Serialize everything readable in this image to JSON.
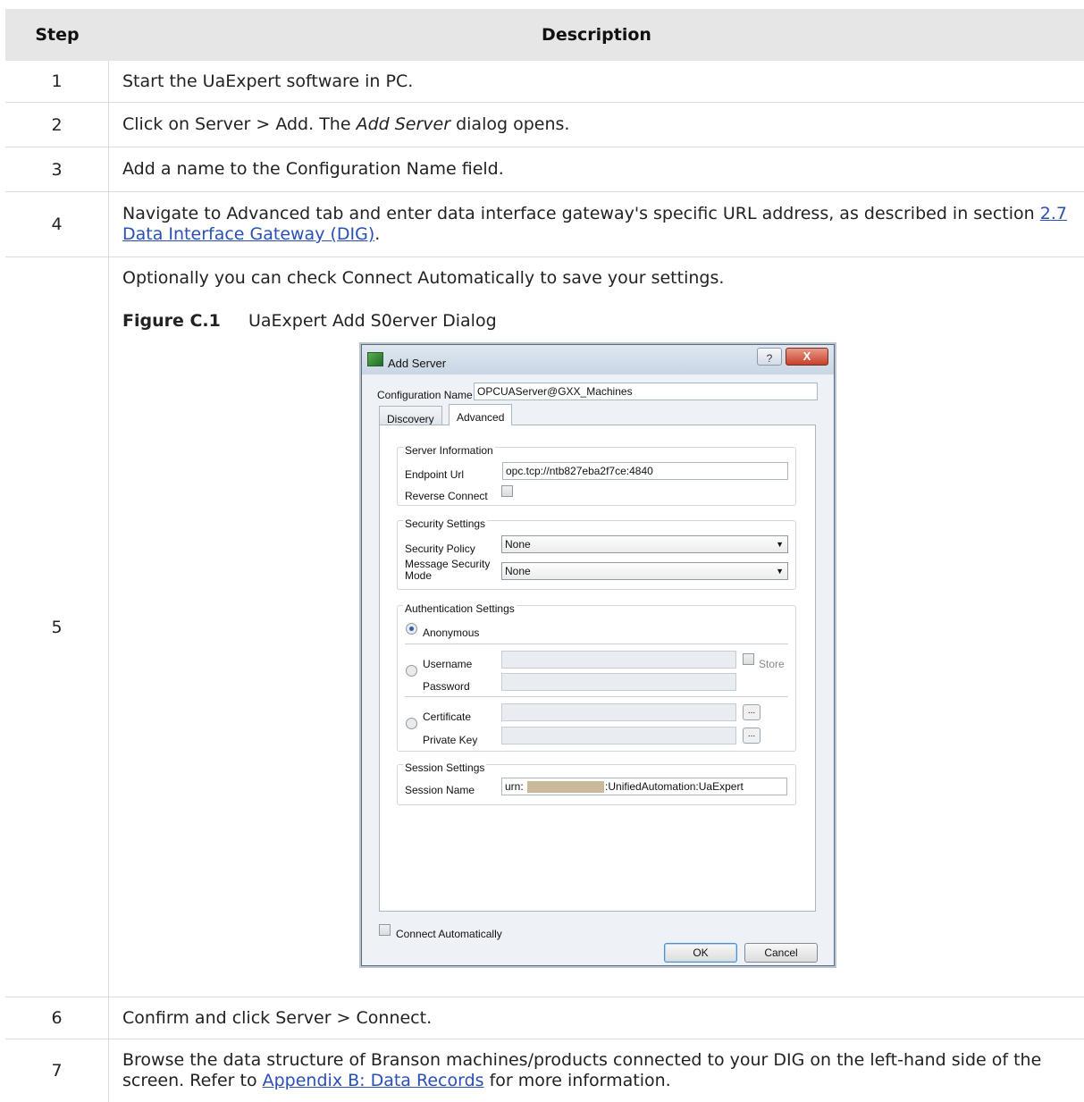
{
  "table": {
    "header": {
      "step": "Step",
      "description": "Description"
    },
    "rows": [
      {
        "step": "1",
        "text": "Start the UaExpert software in PC."
      },
      {
        "step": "2",
        "text_a": "Click on Server > Add. The ",
        "text_em": "Add Server",
        "text_b": " dialog opens."
      },
      {
        "step": "3",
        "text": "Add a name to the Configuration Name field."
      },
      {
        "step": "4",
        "text_a": "Navigate to Advanced tab and enter data interface gateway's specific URL address, as described in section ",
        "link": "2.7 Data Interface Gateway (DIG)",
        "text_b": "."
      },
      {
        "step": "5",
        "text": "Optionally you can check Connect Automatically to save your settings.",
        "figure_label": "Figure C.1",
        "figure_title": "UaExpert Add S0erver Dialog"
      },
      {
        "step": "6",
        "text": "Confirm and click Server > Connect."
      },
      {
        "step": "7",
        "text_a": "Browse the data structure of Branson machines/products connected to your DIG on the left-hand side of the screen. Refer to ",
        "link": "Appendix B: Data Records",
        "text_b": " for more information."
      }
    ]
  },
  "dialog": {
    "title": "Add Server",
    "help": "?",
    "close": "X",
    "config_name_label": "Configuration Name",
    "config_name_value": "OPCUAServer@GXX_Machines",
    "tabs": [
      "Discovery",
      "Advanced"
    ],
    "server_info": {
      "legend": "Server Information",
      "endpoint_label": "Endpoint Url",
      "endpoint_value": "opc.tcp://ntb827eba2f7ce:4840",
      "reverse_label": "Reverse Connect"
    },
    "security": {
      "legend": "Security Settings",
      "policy_label": "Security Policy",
      "policy_value": "None",
      "mode_label": "Message Security Mode",
      "mode_value": "None"
    },
    "auth": {
      "legend": "Authentication Settings",
      "anonymous": "Anonymous",
      "username": "Username",
      "password": "Password",
      "store": "Store",
      "certificate": "Certificate",
      "private_key": "Private Key",
      "browse": "..."
    },
    "session": {
      "legend": "Session Settings",
      "name_label": "Session Name",
      "name_prefix": "urn:",
      "name_suffix": ":UnifiedAutomation:UaExpert"
    },
    "connect_auto": "Connect Automatically",
    "ok": "OK",
    "cancel": "Cancel"
  }
}
